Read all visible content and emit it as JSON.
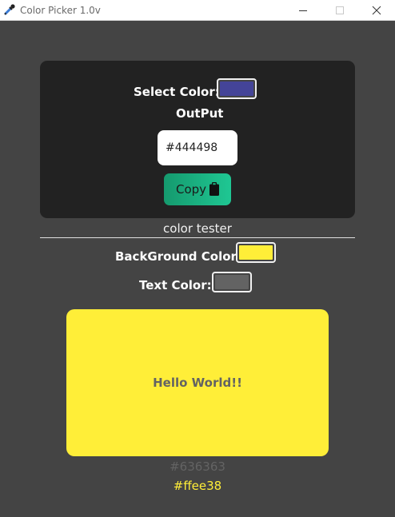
{
  "window": {
    "title": "Color Picker 1.0v",
    "icon": "eyedropper-icon"
  },
  "picker": {
    "select_label": "Select Color:",
    "selected_color": "#444498",
    "output_label": "OutPut",
    "output_value": "#444498",
    "copy_label": "Copy",
    "copy_icon": "clipboard-icon"
  },
  "tester": {
    "title": "color tester",
    "background_label": "BackGround Color:",
    "background_color": "#ffee38",
    "text_label": "Text Color:",
    "text_color": "#636363",
    "preview_text": "Hello World!!",
    "text_color_readout": "#636363",
    "background_color_readout": "#ffee38"
  },
  "colors": {
    "page_bg": "#444444",
    "card_bg": "#222222",
    "accent_start": "#159a6e",
    "accent_end": "#1fc793"
  }
}
